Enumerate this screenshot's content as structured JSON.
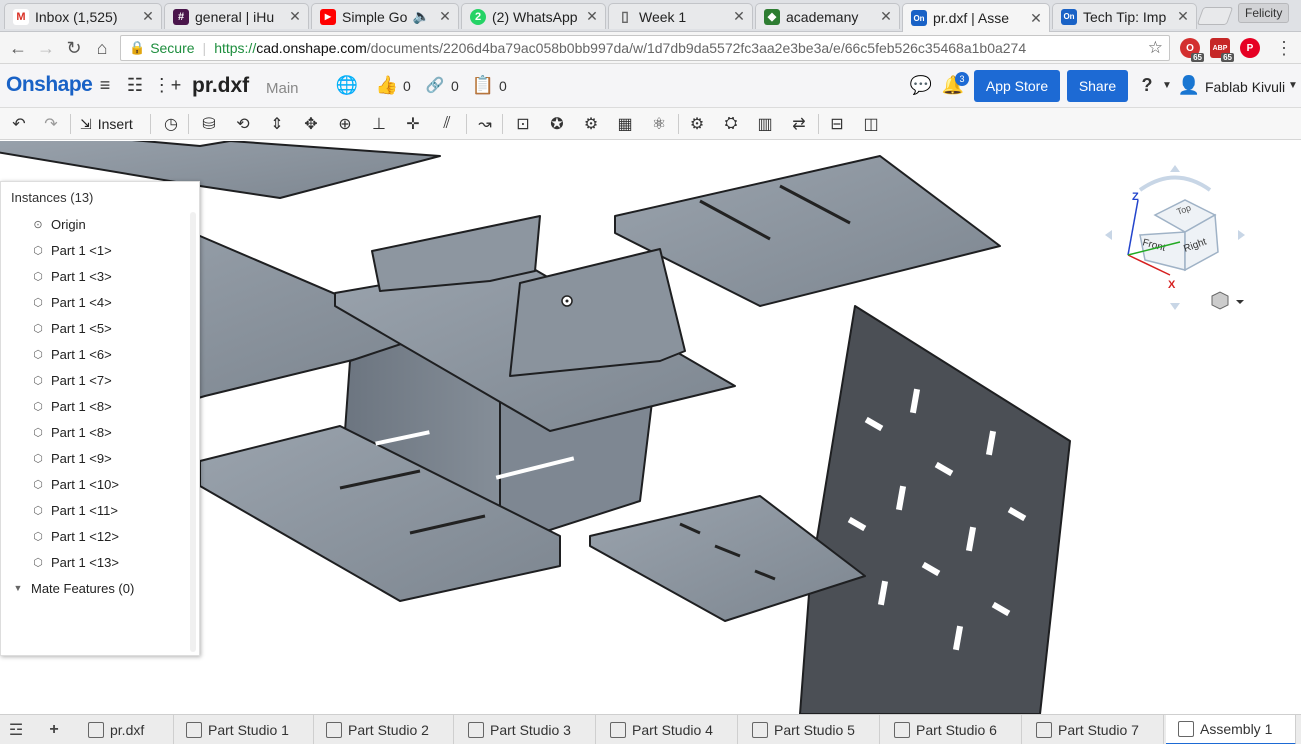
{
  "browser": {
    "tabs": [
      {
        "title": "Inbox (1,525)",
        "color": "#d93025",
        "glyph": "M"
      },
      {
        "title": "general | iHu",
        "color": "#4a154b",
        "glyph": "#"
      },
      {
        "title": "Simple Go",
        "color": "#ff0000",
        "glyph": "▶"
      },
      {
        "title": "(2) WhatsApp",
        "color": "#25d366",
        "glyph": "2"
      },
      {
        "title": "Week 1",
        "color": "#888888",
        "glyph": "▯"
      },
      {
        "title": "academany",
        "color": "#2e7d32",
        "glyph": "◆"
      },
      {
        "title": "pr.dxf | Asse",
        "color": "#1962c6",
        "glyph": "On"
      },
      {
        "title": "Tech Tip: Imp",
        "color": "#1962c6",
        "glyph": "On"
      }
    ],
    "profile": "Felicity",
    "secure_label": "Secure",
    "url_scheme": "https://",
    "url_host": "cad.onshape.com",
    "url_path": "/documents/2206d4ba79ac058b0bb997da/w/1d7db9da5572fc3aa2e3be3a/e/66c5feb526c35468a1b0a274",
    "ext_badge_1": "65",
    "ext_badge_2": "65"
  },
  "header": {
    "logo": "Onshape",
    "doc_name": "pr.dxf",
    "branch": "Main",
    "likes": "0",
    "links": "0",
    "copies": "0",
    "notif_count": "3",
    "app_store": "App Store",
    "share": "Share",
    "help": "?",
    "user": "Fablab Kivuli"
  },
  "toolbar": {
    "insert": "Insert"
  },
  "instances": {
    "title": "Instances (13)",
    "origin": "Origin",
    "parts": [
      "Part 1 <1>",
      "Part 1 <3>",
      "Part 1 <4>",
      "Part 1 <5>",
      "Part 1 <6>",
      "Part 1 <7>",
      "Part 1 <8>",
      "Part 1 <8>",
      "Part 1 <9>",
      "Part 1 <10>",
      "Part 1 <11>",
      "Part 1 <12>",
      "Part 1 <13>"
    ],
    "mates": "Mate Features (0)"
  },
  "viewcube": {
    "top": "Top",
    "front": "Front",
    "right": "Right",
    "axis_x": "X",
    "axis_z": "Z"
  },
  "bottom_tabs": [
    {
      "label": "pr.dxf"
    },
    {
      "label": "Part Studio 1"
    },
    {
      "label": "Part Studio 2"
    },
    {
      "label": "Part Studio 3"
    },
    {
      "label": "Part Studio 4"
    },
    {
      "label": "Part Studio 5"
    },
    {
      "label": "Part Studio 6"
    },
    {
      "label": "Part Studio 7"
    },
    {
      "label": "Assembly 1"
    }
  ],
  "colors": {
    "accent": "#1d6ad4",
    "panel": "#8a939e",
    "panel_dark": "#4b4f55"
  }
}
